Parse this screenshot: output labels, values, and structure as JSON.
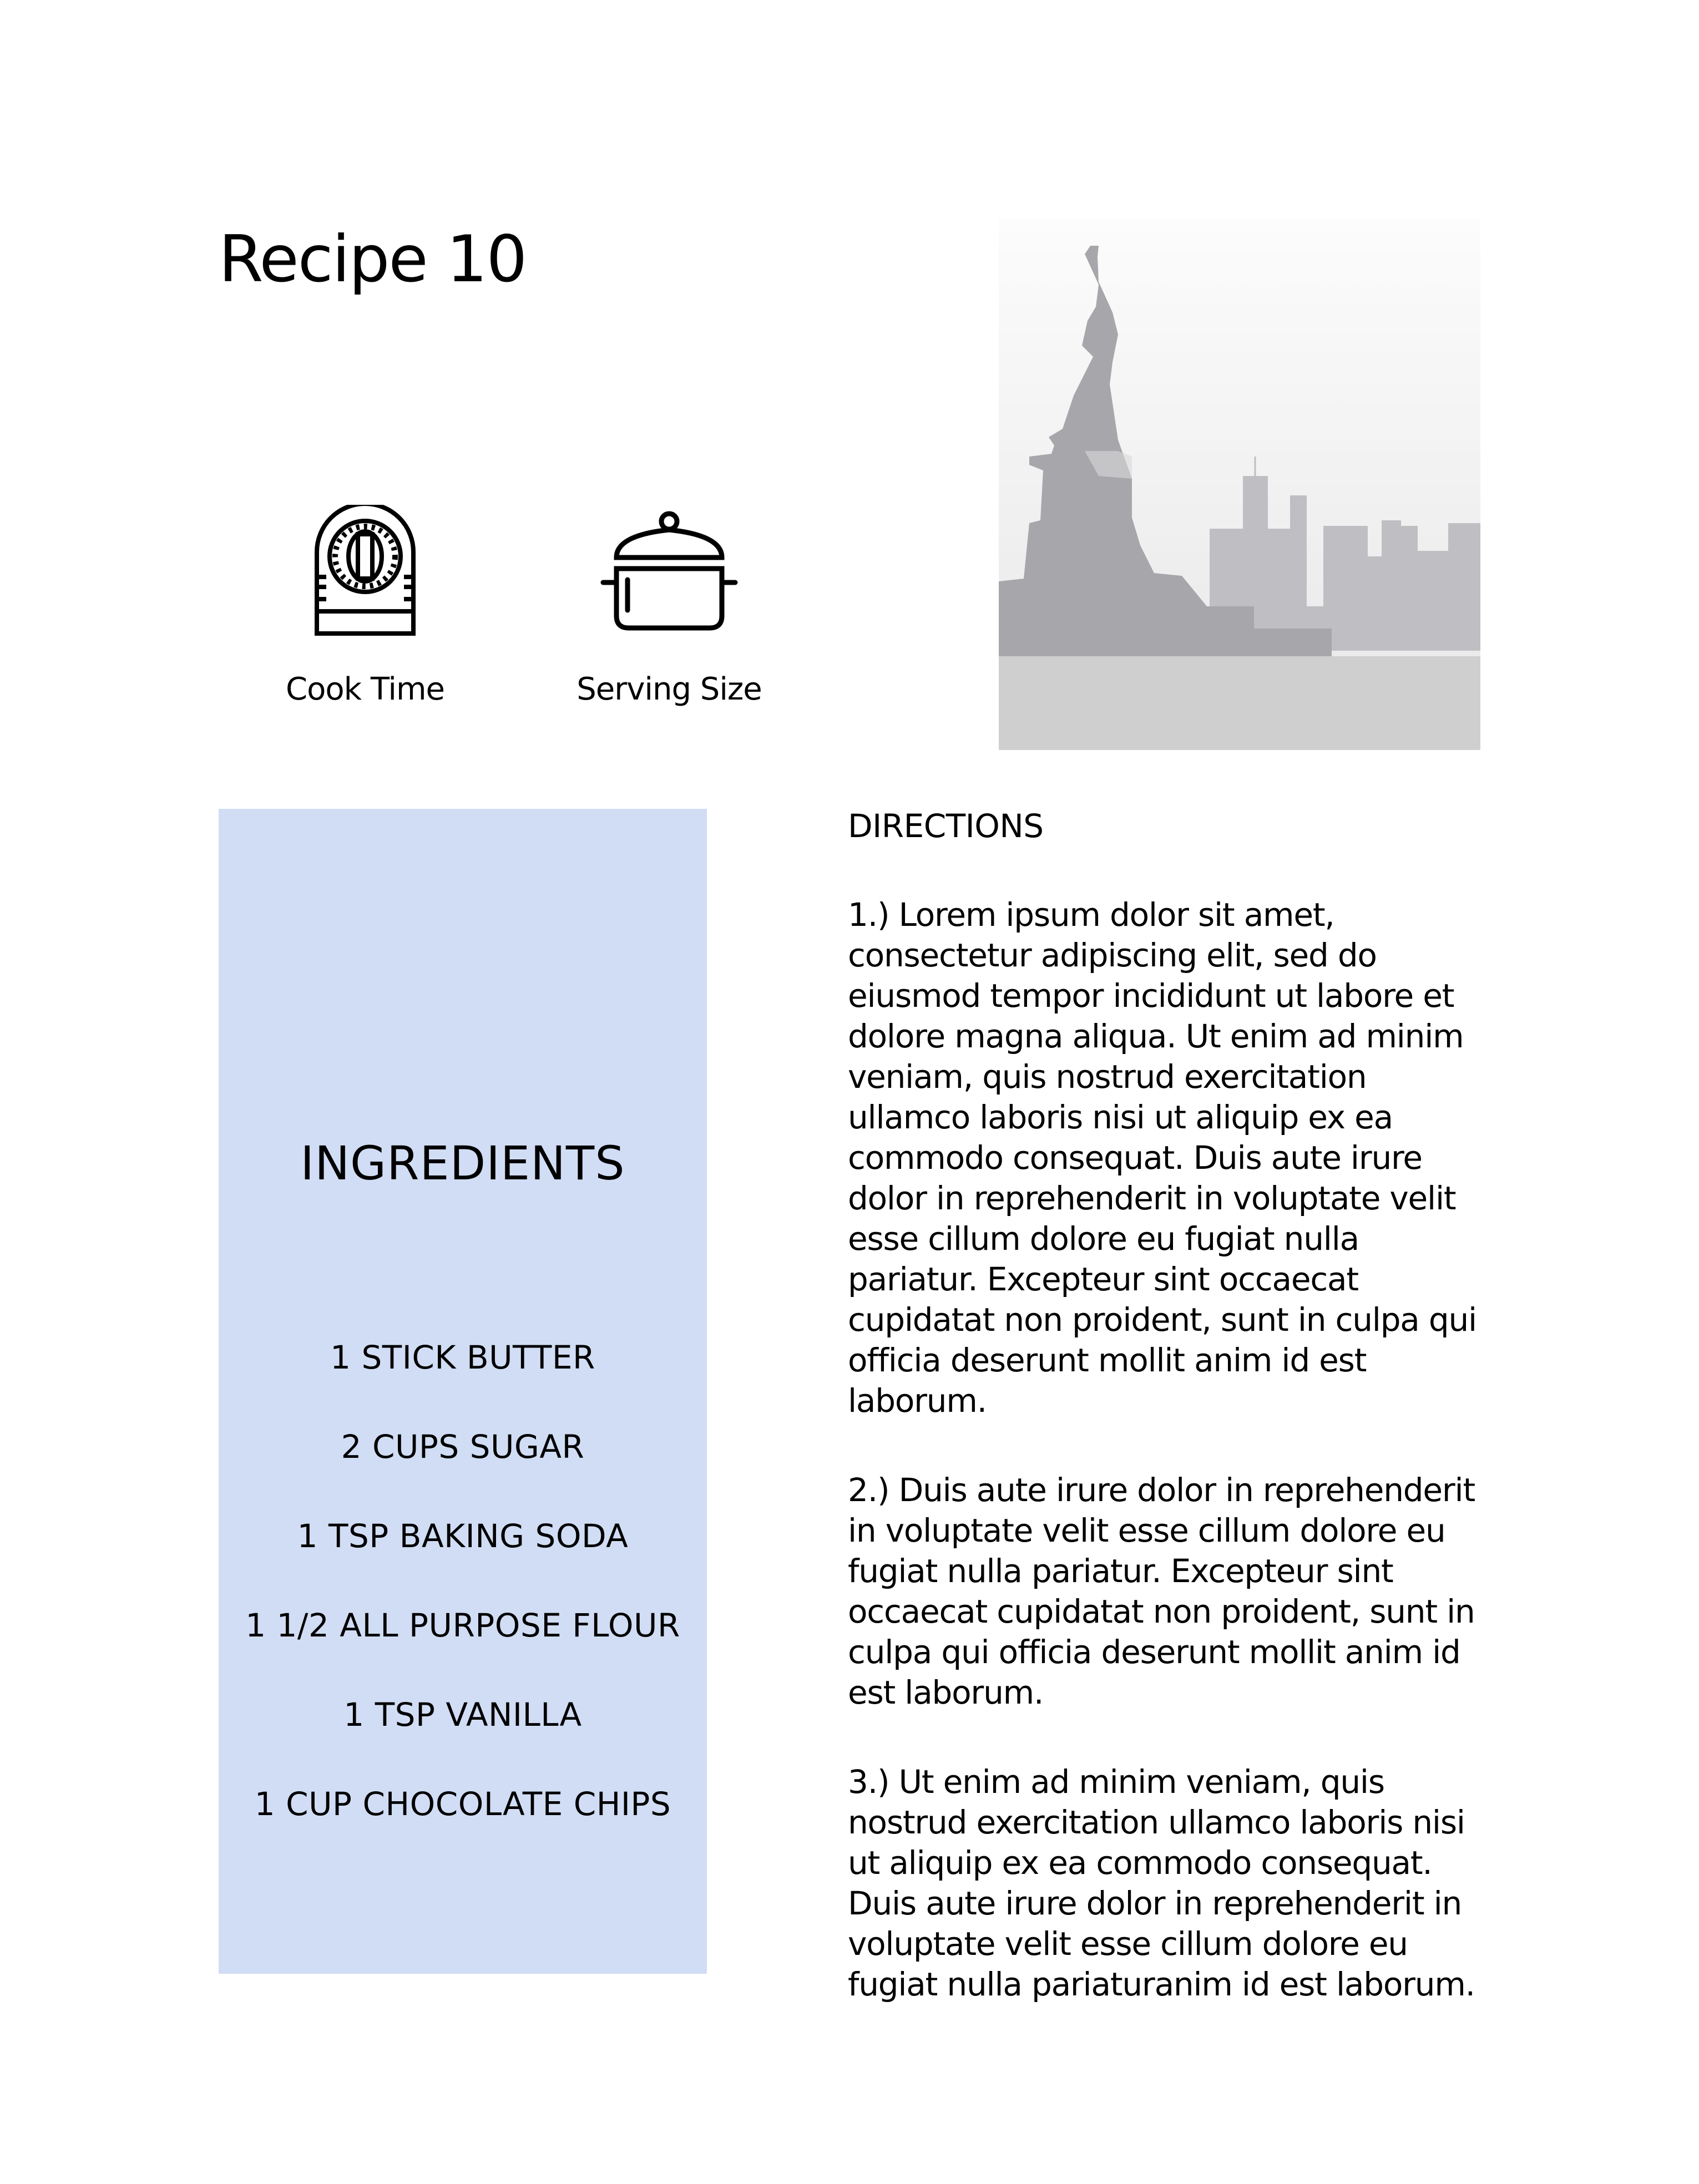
{
  "header": {
    "title": "Recipe 10"
  },
  "meta": [
    {
      "icon": "kitchen-timer-icon",
      "label": "Cook Time"
    },
    {
      "icon": "cooking-pot-icon",
      "label": "Serving Size"
    }
  ],
  "hero_image": {
    "subject": "statue-of-liberty-skyline"
  },
  "ingredients": {
    "title": "INGREDIENTS",
    "background": "#d1ddf4",
    "items": [
      "1 STICK BUTTER",
      "2 CUPS SUGAR",
      "1 TSP BAKING SODA",
      "1 1/2 ALL PURPOSE FLOUR",
      "1 TSP VANILLA",
      "1 CUP CHOCOLATE CHIPS"
    ]
  },
  "directions": {
    "title": "DIRECTIONS",
    "steps": [
      "1.) Lorem ipsum dolor sit amet, consectetur adipiscing elit, sed do eiusmod tempor incididunt ut labore et dolore magna aliqua. Ut enim ad minim veniam, quis nostrud exercitation ullamco laboris nisi ut aliquip ex ea commodo consequat. Duis aute irure dolor in reprehenderit in voluptate velit esse cillum dolore eu fugiat nulla pariatur. Excepteur sint occaecat cupidatat non proident, sunt in culpa qui officia deserunt mollit anim id est laborum.",
      "2.) Duis aute irure dolor in reprehenderit in voluptate velit esse cillum dolore eu fugiat nulla pariatur. Excepteur sint occaecat cupidatat non proident, sunt in culpa qui officia deserunt mollit anim id est laborum.",
      "3.) Ut enim ad minim veniam, quis nostrud exercitation ullamco laboris nisi ut aliquip ex ea commodo consequat. Duis aute irure dolor in reprehenderit in voluptate velit esse cillum dolore eu fugiat nulla pariaturanim id est laborum."
    ]
  }
}
